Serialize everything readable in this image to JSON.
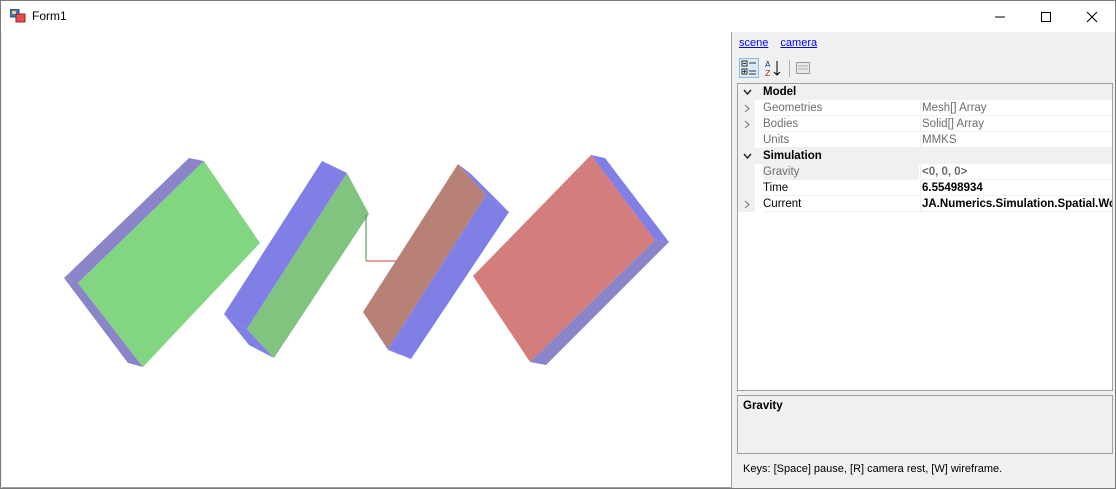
{
  "window": {
    "title": "Form1"
  },
  "links": {
    "scene": "scene",
    "camera": "camera"
  },
  "property_grid": {
    "categories": [
      {
        "name": "Model",
        "properties": [
          {
            "name": "Geometries",
            "value": "Mesh[] Array",
            "expandable": true
          },
          {
            "name": "Bodies",
            "value": "Solid[] Array",
            "expandable": true
          },
          {
            "name": "Units",
            "value": "MMKS",
            "expandable": false
          }
        ]
      },
      {
        "name": "Simulation",
        "properties": [
          {
            "name": "Gravity",
            "value": "<0, 0, 0>",
            "expandable": false
          },
          {
            "name": "Time",
            "value": "6.55498934",
            "expandable": false
          },
          {
            "name": "Current",
            "value": "JA.Numerics.Simulation.Spatial.World",
            "expandable": true
          }
        ]
      }
    ]
  },
  "help": {
    "title": "Gravity"
  },
  "status": {
    "keys": "Keys: [Space] pause, [R] camera rest, [W] wireframe."
  },
  "colors": {
    "green_face": "#82d682",
    "blue_face": "#7f7fe6",
    "red_face": "#d47d7d",
    "brown_face": "#b88176",
    "shade_face": "#8a85c9",
    "link": "#0000ff"
  }
}
